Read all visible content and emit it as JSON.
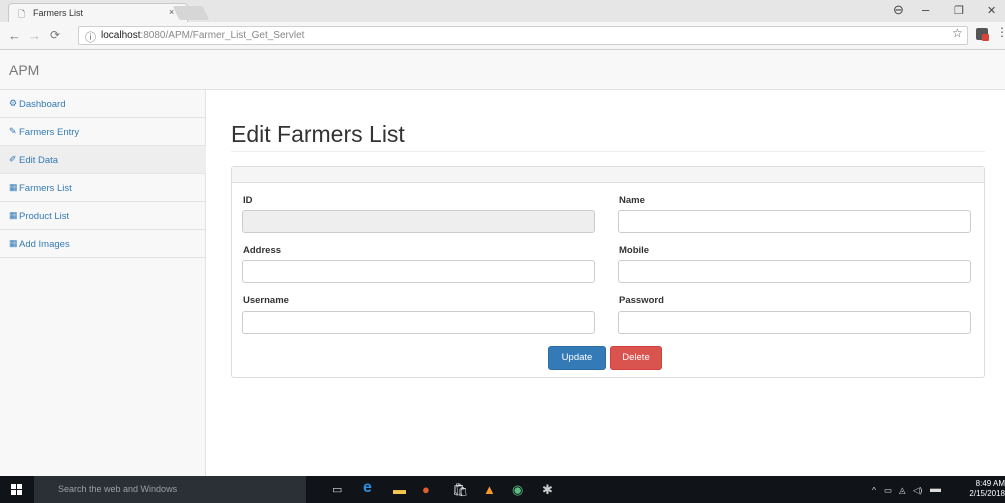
{
  "browser": {
    "tab_title": "Farmers List",
    "tab_close": "×",
    "url_host": "localhost",
    "url_path": ":8080/APM/Farmer_List_Get_Servlet",
    "win_controls": {
      "account": "⊖",
      "minimize": "–",
      "maximize": "❐",
      "close": "✕"
    }
  },
  "app": {
    "brand": "APM"
  },
  "sidebar": {
    "items": [
      {
        "label": "Dashboard",
        "icon": "⚙"
      },
      {
        "label": "Farmers Entry",
        "icon": "✎"
      },
      {
        "label": "Edit Data",
        "icon": "✐"
      },
      {
        "label": "Farmers List",
        "icon": "▦"
      },
      {
        "label": "Product List",
        "icon": "▦"
      },
      {
        "label": "Add Images",
        "icon": "▦"
      }
    ]
  },
  "main": {
    "title": "Edit Farmers List",
    "form": {
      "id_label": "ID",
      "name_label": "Name",
      "address_label": "Address",
      "mobile_label": "Mobile",
      "username_label": "Username",
      "password_label": "Password",
      "id_value": "",
      "name_value": "",
      "address_value": "",
      "mobile_value": "",
      "username_value": "",
      "password_value": ""
    },
    "buttons": {
      "update": "Update",
      "delete": "Delete"
    }
  },
  "taskbar": {
    "search_placeholder": "Search the web and Windows",
    "time": "8:49 AM",
    "date": "2/15/2018"
  },
  "colors": {
    "primary": "#337ab7",
    "danger": "#d9534f",
    "link": "#337ab7",
    "taskbar": "#101318"
  }
}
